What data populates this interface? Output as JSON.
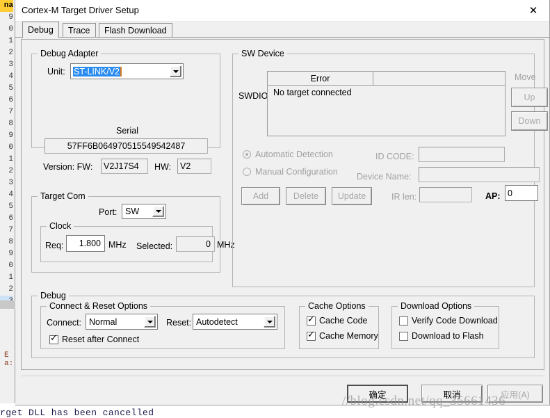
{
  "window": {
    "title": "Cortex-M Target Driver Setup",
    "close_label": "✕"
  },
  "tabs": [
    {
      "label": "Debug",
      "active": true
    },
    {
      "label": "Trace",
      "active": false
    },
    {
      "label": "Flash Download",
      "active": false
    }
  ],
  "debug_adapter": {
    "legend": "Debug Adapter",
    "unit_label": "Unit:",
    "unit_value": "ST-LINK/V2",
    "serial_label": "Serial",
    "serial_value": "57FF6B064970515549542487",
    "version_label": "Version: FW:",
    "fw_value": "V2J17S4",
    "hw_label": "HW:",
    "hw_value": "V2"
  },
  "target_com": {
    "legend": "Target Com",
    "port_label": "Port:",
    "port_value": "SW",
    "clock_legend": "Clock",
    "req_label": "Req:",
    "req_value": "1.800",
    "req_unit": "MHz",
    "selected_label": "Selected:",
    "selected_value": "0",
    "selected_unit": "MHz"
  },
  "sw_device": {
    "legend": "SW Device",
    "swdio_label": "SWDIO",
    "column_error": "Error",
    "column_blank": "",
    "row_error": "No target connected",
    "move_label": "Move",
    "up_label": "Up",
    "down_label": "Down",
    "automatic_detection": "Automatic Detection",
    "manual_configuration": "Manual Configuration",
    "id_code_label": "ID CODE:",
    "id_code_value": "",
    "device_name_label": "Device Name:",
    "device_name_value": "",
    "ir_len_label": "IR len:",
    "ir_len_value": "",
    "ap_label": "AP:",
    "ap_value": "0",
    "add_label": "Add",
    "delete_label": "Delete",
    "update_label": "Update"
  },
  "debug_section": {
    "legend": "Debug",
    "connect_reset": {
      "legend": "Connect & Reset Options",
      "connect_label": "Connect:",
      "connect_value": "Normal",
      "reset_label": "Reset:",
      "reset_value": "Autodetect",
      "reset_after_connect_label": "Reset after Connect",
      "reset_after_connect_checked": true
    },
    "cache_options": {
      "legend": "Cache Options",
      "cache_code_label": "Cache Code",
      "cache_code_checked": true,
      "cache_memory_label": "Cache Memory",
      "cache_memory_checked": true
    },
    "download_options": {
      "legend": "Download Options",
      "verify_code_label": "Verify Code Download",
      "verify_code_checked": false,
      "download_flash_label": "Download to Flash",
      "download_flash_checked": false
    }
  },
  "footer": {
    "ok_label": "确定",
    "cancel_label": "取消",
    "apply_label": "应用(A)"
  },
  "background": {
    "watermark": "//blog.csdn.net/qq_35661436",
    "status_text": "rget DLL has been cancelled",
    "gutter_lines": [
      "na",
      "9",
      "0",
      "1",
      "2",
      "3",
      "4",
      "5",
      "6",
      "7",
      "8",
      "9",
      "0",
      "1",
      "2",
      "3",
      "4",
      "5",
      "6",
      "7",
      "8",
      "9",
      "0",
      "1",
      "2",
      "3"
    ],
    "left_word_1": "E",
    "left_word_2": "a:"
  },
  "colors": {
    "dialog_bg": "#f0f0f0",
    "selection_blue": "#2a8cf0",
    "caret_orange": "#e07b20",
    "disabled_text": "#a0a0a0"
  }
}
